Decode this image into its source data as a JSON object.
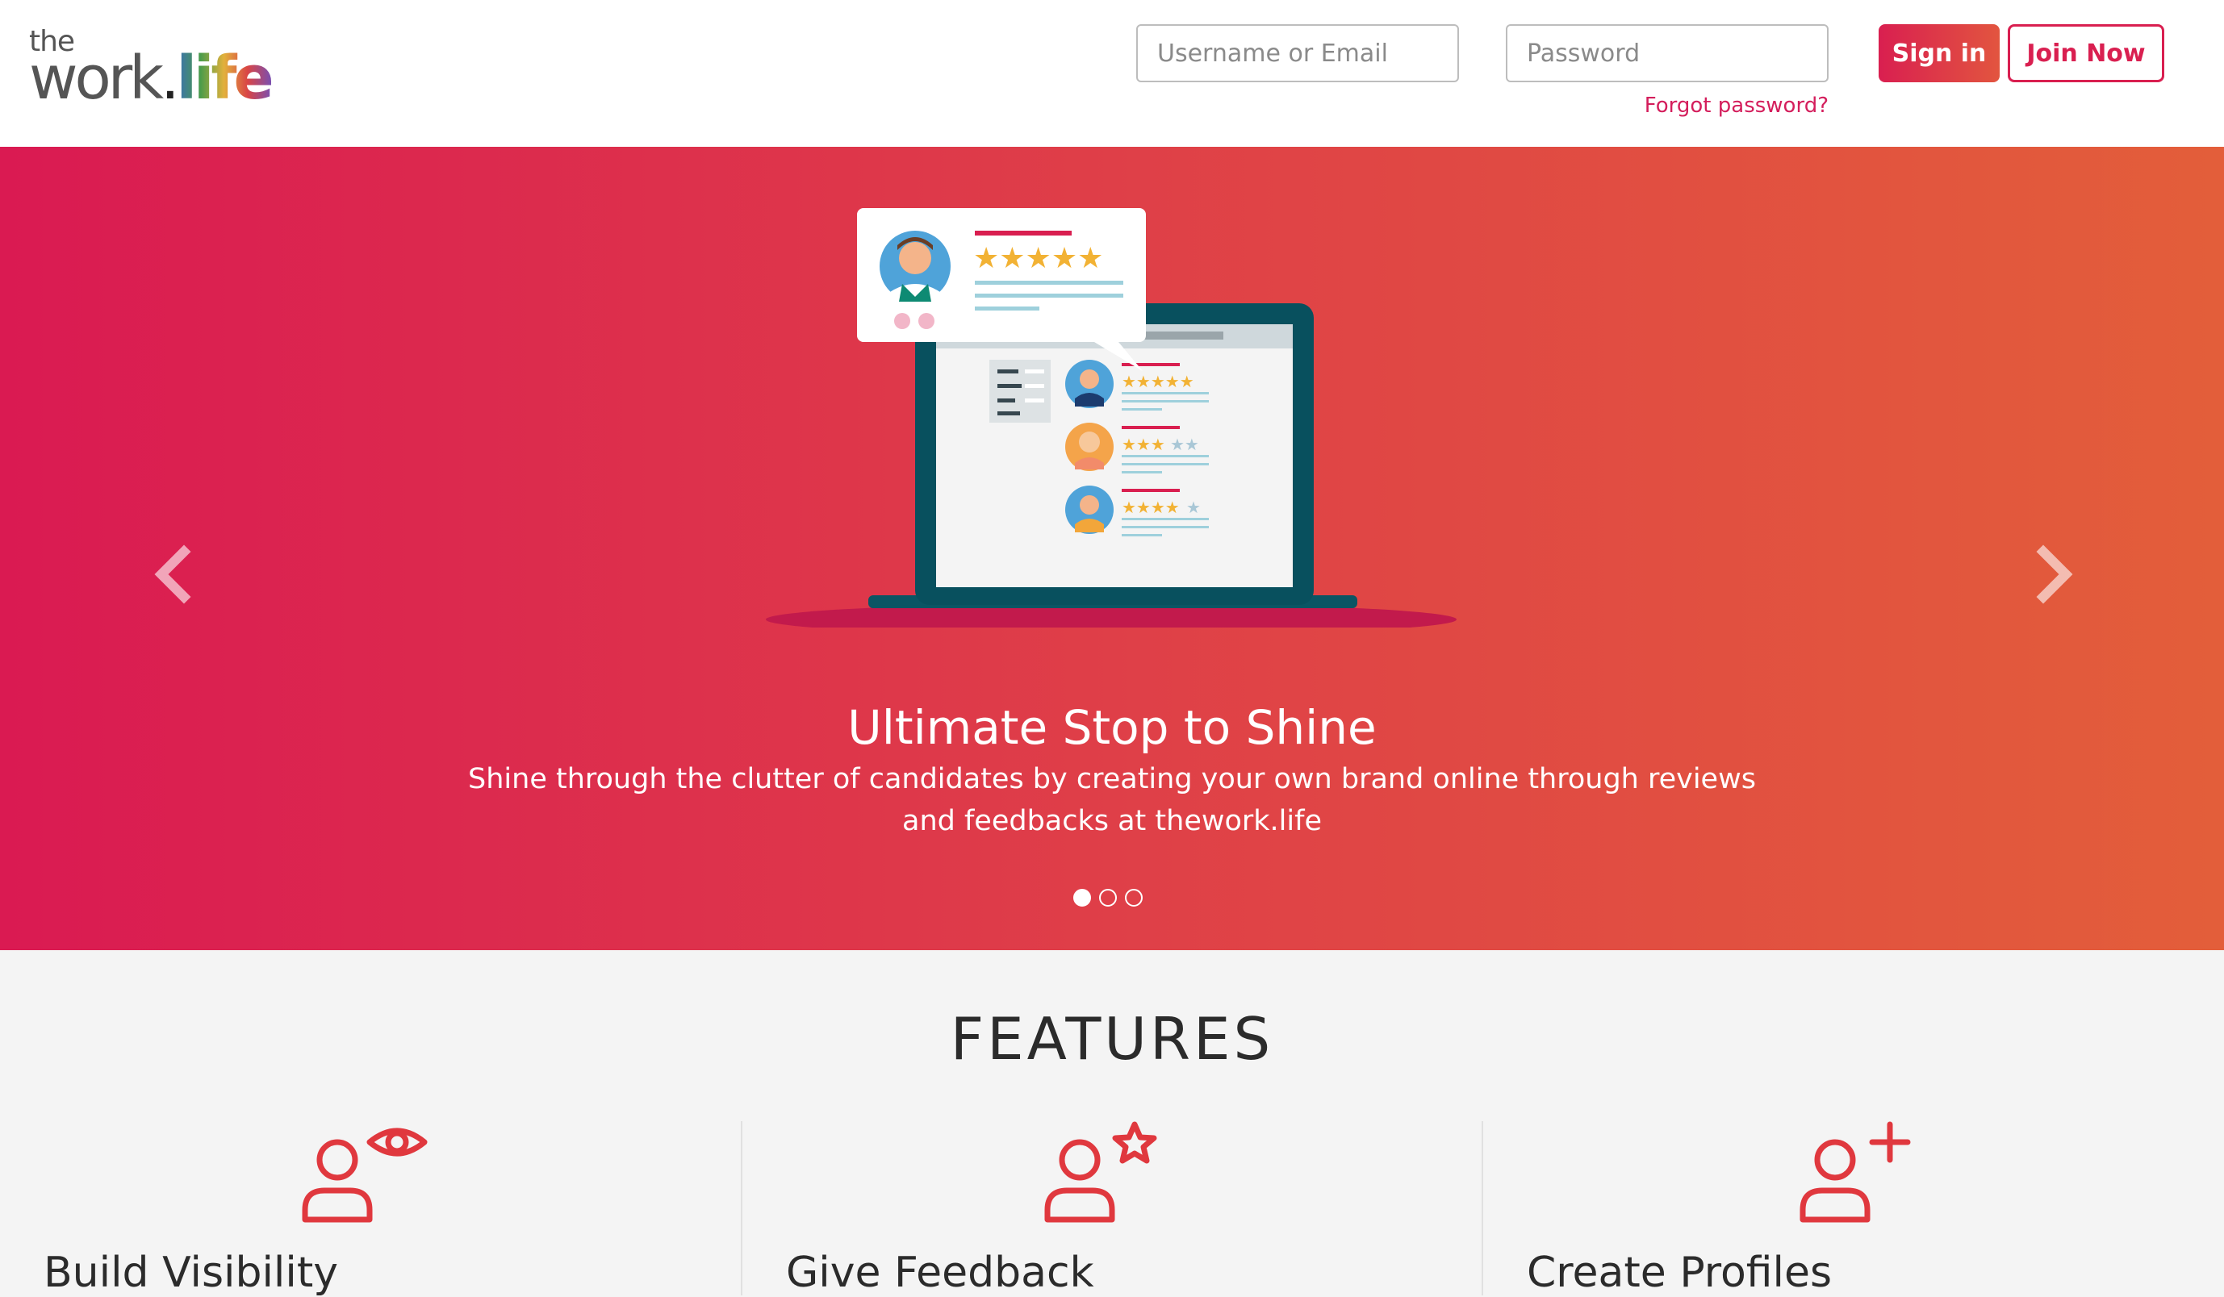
{
  "header": {
    "logo_small": "the",
    "logo_main": "work",
    "logo_dot": ".",
    "logo_tld": "life",
    "username_placeholder": "Username or Email",
    "password_placeholder": "Password",
    "forgot_label": "Forgot password?",
    "signin_label": "Sign in",
    "join_label": "Join Now"
  },
  "hero": {
    "title": "Ultimate Stop to Shine",
    "text": "Shine through the clutter of candidates by creating your own brand online through reviews and feedbacks at thework.life",
    "slide_count": 3,
    "active_slide": 1,
    "prev_icon": "chevron-left-icon",
    "next_icon": "chevron-right-icon"
  },
  "features": {
    "title": "FEATURES",
    "items": [
      {
        "label": "Build Visibility",
        "icon": "user-eye-icon"
      },
      {
        "label": "Give Feedback",
        "icon": "user-star-icon"
      },
      {
        "label": "Create Profiles",
        "icon": "user-plus-icon"
      }
    ]
  },
  "colors": {
    "brand": "#d91f50",
    "hero_start": "#da1a52",
    "hero_end": "#e35e3a",
    "icon": "#e0383e"
  }
}
